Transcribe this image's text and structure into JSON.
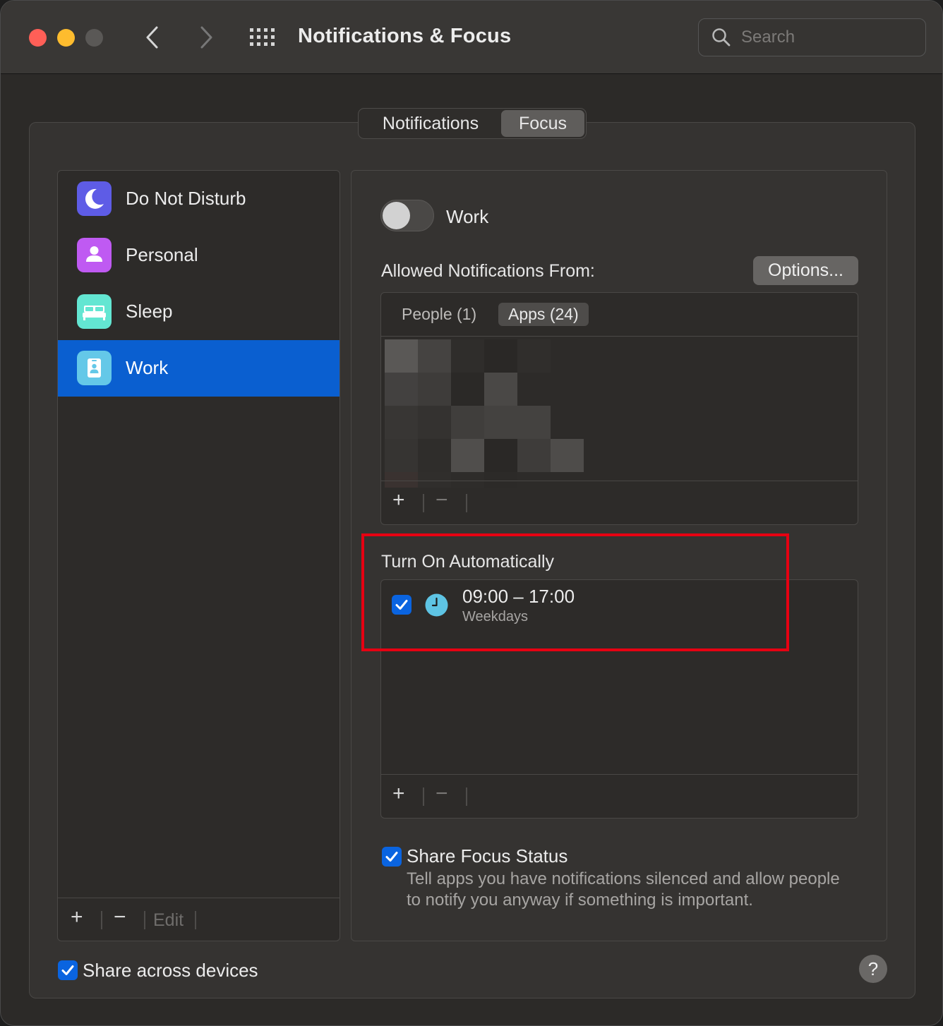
{
  "window": {
    "title": "Notifications & Focus",
    "search_placeholder": "Search"
  },
  "tabs": [
    {
      "label": "Notifications",
      "selected": false
    },
    {
      "label": "Focus",
      "selected": true
    }
  ],
  "sidebar": {
    "items": [
      {
        "label": "Do Not Disturb",
        "icon": "moon-icon",
        "color": "#5e5ce6"
      },
      {
        "label": "Personal",
        "icon": "person-icon",
        "color": "#bf5af2"
      },
      {
        "label": "Sleep",
        "icon": "bed-icon",
        "color": "#63e6d2"
      },
      {
        "label": "Work",
        "icon": "id-badge-icon",
        "color": "#64c8e8",
        "selected": true
      }
    ],
    "footer": {
      "add": "+",
      "remove": "−",
      "edit": "Edit"
    }
  },
  "focus": {
    "name": "Work",
    "enabled": false,
    "allowed_label": "Allowed Notifications From:",
    "options_button": "Options...",
    "allowed_tabs": [
      {
        "label": "People (1)",
        "selected": false
      },
      {
        "label": "Apps (24)",
        "selected": true
      }
    ],
    "apps_footer": {
      "add": "+",
      "remove": "−"
    },
    "auto_label": "Turn On Automatically",
    "schedule": {
      "enabled": true,
      "time": "09:00 – 17:00",
      "days": "Weekdays"
    },
    "auto_footer": {
      "add": "+",
      "remove": "−"
    },
    "share_focus_status": {
      "checked": true,
      "label": "Share Focus Status",
      "description": "Tell apps you have notifications silenced and allow people to notify you anyway if something is important."
    }
  },
  "share_across_devices": {
    "checked": true,
    "label": "Share across devices"
  },
  "help": "?",
  "colors": {
    "accent": "#0a5fd0",
    "checkbox": "#0a64e0",
    "highlight": "#e60012"
  }
}
